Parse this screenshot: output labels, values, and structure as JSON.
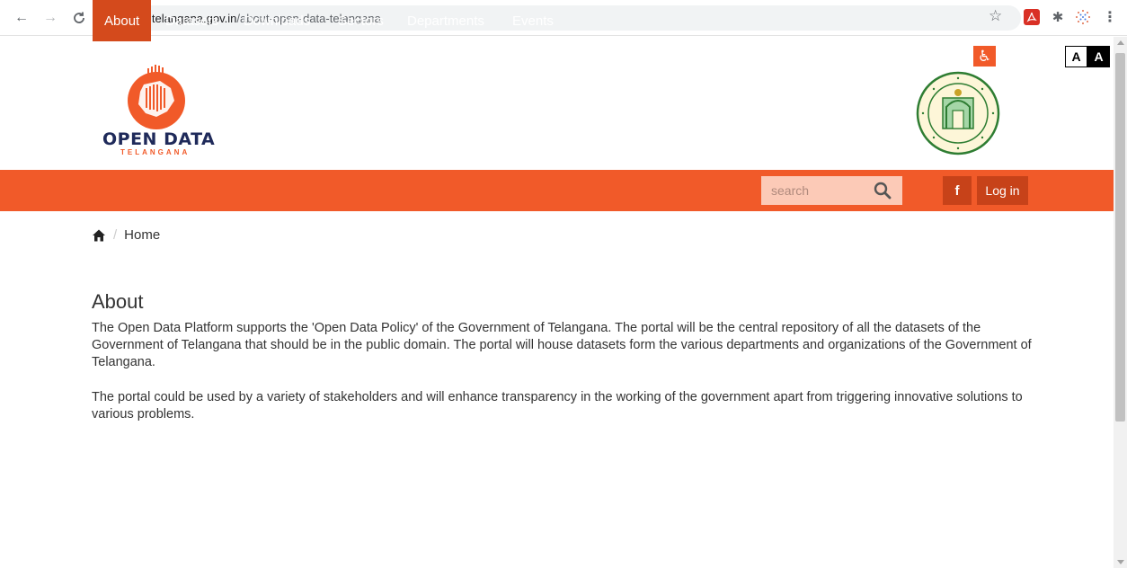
{
  "browser": {
    "url_host": "data.telangana.gov.in",
    "url_path": "/about-open-data-telangana"
  },
  "header": {
    "logo_title": "OPEN DATA",
    "logo_subtitle": "TELANGANA",
    "font_small": "A",
    "font_large": "A"
  },
  "nav": {
    "items": [
      {
        "label": "About"
      },
      {
        "label": "Datasets"
      },
      {
        "label": "Downloads"
      },
      {
        "label": "Sectors"
      },
      {
        "label": "Departments"
      },
      {
        "label": "Events"
      }
    ],
    "search_placeholder": "search",
    "facebook_label": "f",
    "login_label": "Log in"
  },
  "breadcrumb": {
    "separator": "/",
    "current": "Home"
  },
  "content": {
    "heading": "About",
    "paragraph1": "The Open Data Platform supports the 'Open Data Policy' of the Government of Telangana. The portal will be the central repository of all the datasets of the Government of Telangana that should be in the public domain. The portal will house datasets form the various departments and organizations of the Government of Telangana.",
    "paragraph2": "The portal could be used by a variety of stakeholders and will enhance transparency in the working of the government apart from triggering innovative solutions to various problems."
  },
  "colors": {
    "brand": "#f15a29",
    "nav_active": "#d44a1c",
    "button_dark": "#c74219",
    "logo_navy": "#1f2a5a"
  }
}
